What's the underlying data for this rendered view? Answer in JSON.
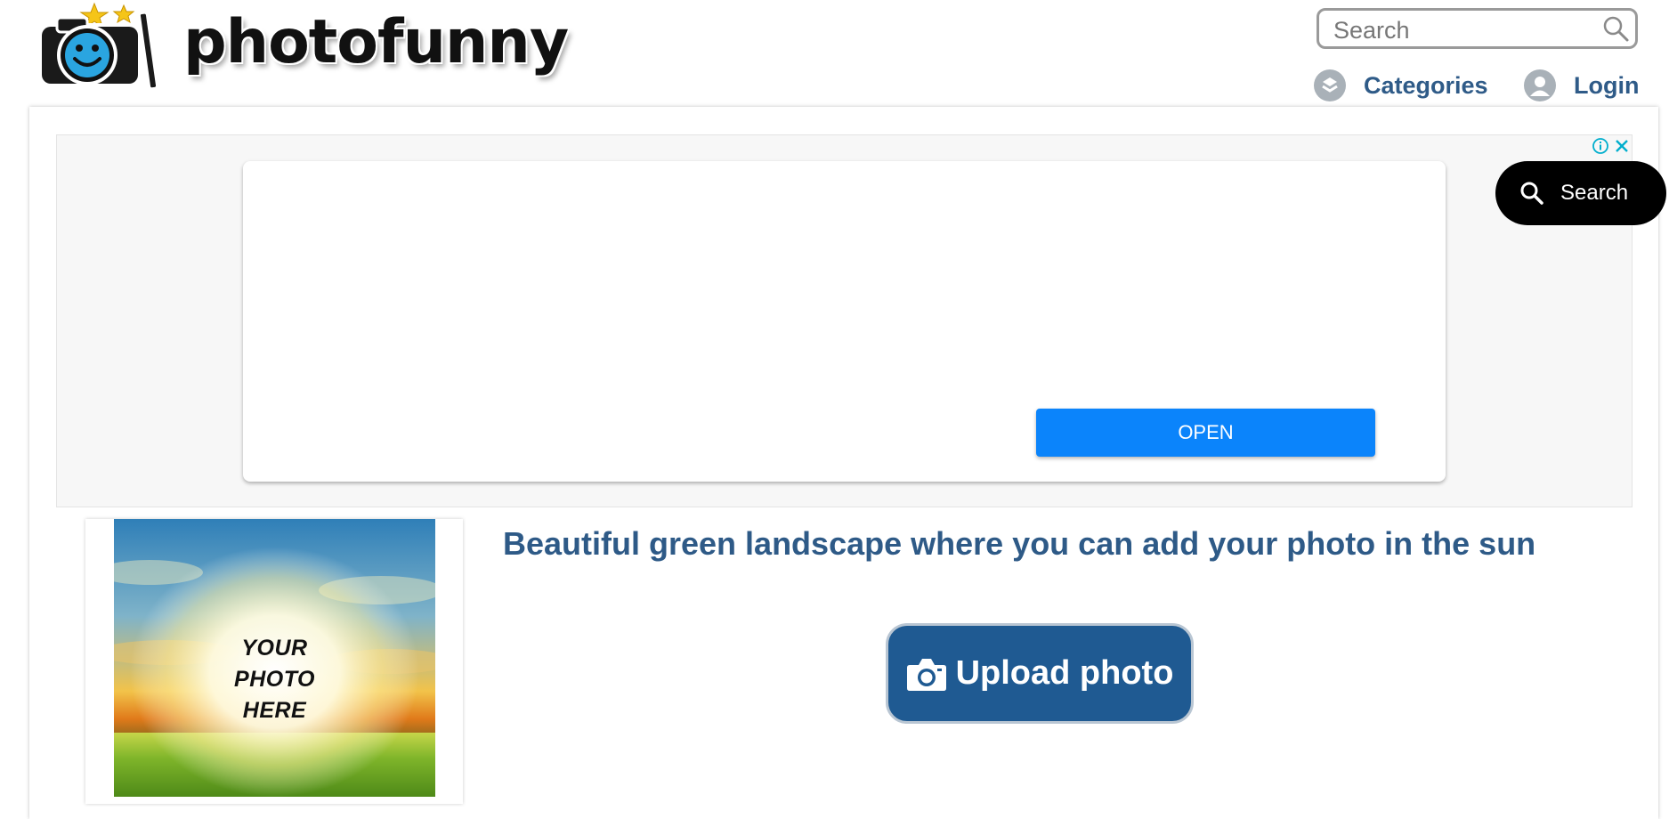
{
  "header": {
    "logo_text": "photofunny",
    "search_placeholder": "Search",
    "nav": {
      "categories": "Categories",
      "login": "Login"
    }
  },
  "ad": {
    "open_label": "OPEN"
  },
  "floating_search": {
    "label": "Search"
  },
  "content": {
    "title": "Beautiful green landscape where you can add your photo in the sun",
    "thumbnail_caption": [
      "YOUR",
      "PHOTO",
      "HERE"
    ],
    "upload_label": "Upload photo"
  },
  "colors": {
    "nav_text": "#2f5b88",
    "title_text": "#2e5a87",
    "upload_button": "#1f5a92",
    "ad_button": "#0b84fb",
    "floating_search_bg": "#000000"
  }
}
